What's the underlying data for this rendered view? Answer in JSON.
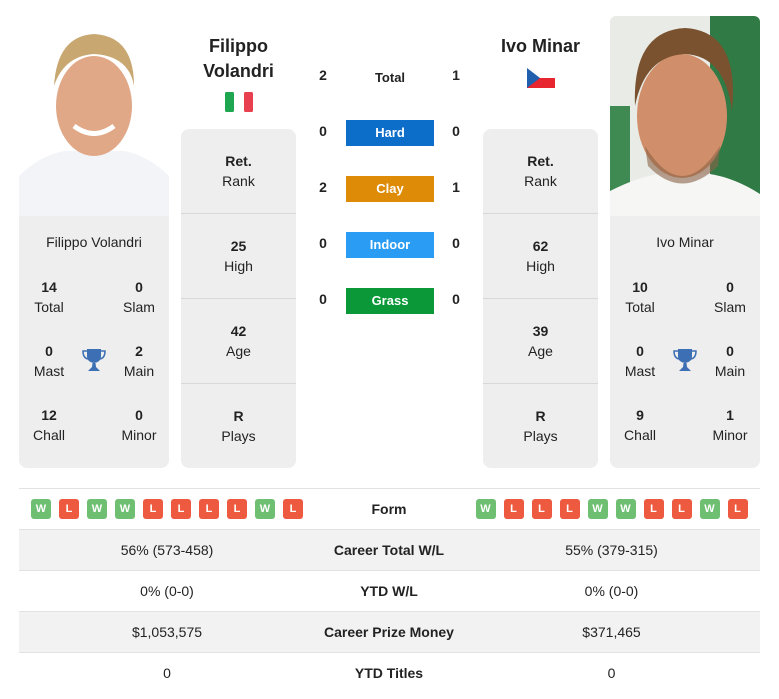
{
  "colors": {
    "hard": "#0c6ec8",
    "clay": "#de8b07",
    "indoor": "#2a9cf3",
    "grass": "#0a9838",
    "win": "#6fbf73",
    "loss": "#ee5a3f",
    "trophy": "#3d6fb4"
  },
  "player1": {
    "name": "Filippo Volandri",
    "name_line1": "Filippo",
    "name_line2": "Volandri",
    "flag": "italy-flag",
    "titles": {
      "total": {
        "value": "14",
        "label": "Total"
      },
      "slam": {
        "value": "0",
        "label": "Slam"
      },
      "mast": {
        "value": "0",
        "label": "Mast"
      },
      "main": {
        "value": "2",
        "label": "Main"
      },
      "chall": {
        "value": "12",
        "label": "Chall"
      },
      "minor": {
        "value": "0",
        "label": "Minor"
      }
    },
    "info": {
      "rank": {
        "value": "Ret.",
        "label": "Rank"
      },
      "high": {
        "value": "25",
        "label": "High"
      },
      "age": {
        "value": "42",
        "label": "Age"
      },
      "plays": {
        "value": "R",
        "label": "Plays"
      }
    },
    "form": [
      "W",
      "L",
      "W",
      "W",
      "L",
      "L",
      "L",
      "L",
      "W",
      "L"
    ],
    "career_wl": "56% (573-458)",
    "ytd_wl": "0% (0-0)",
    "prize_money": "$1,053,575",
    "ytd_titles": "0"
  },
  "player2": {
    "name": "Ivo Minar",
    "flag": "czech-flag",
    "titles": {
      "total": {
        "value": "10",
        "label": "Total"
      },
      "slam": {
        "value": "0",
        "label": "Slam"
      },
      "mast": {
        "value": "0",
        "label": "Mast"
      },
      "main": {
        "value": "0",
        "label": "Main"
      },
      "chall": {
        "value": "9",
        "label": "Chall"
      },
      "minor": {
        "value": "1",
        "label": "Minor"
      }
    },
    "info": {
      "rank": {
        "value": "Ret.",
        "label": "Rank"
      },
      "high": {
        "value": "62",
        "label": "High"
      },
      "age": {
        "value": "39",
        "label": "Age"
      },
      "plays": {
        "value": "R",
        "label": "Plays"
      }
    },
    "form": [
      "W",
      "L",
      "L",
      "L",
      "W",
      "W",
      "L",
      "L",
      "W",
      "L"
    ],
    "career_wl": "55% (379-315)",
    "ytd_wl": "0% (0-0)",
    "prize_money": "$371,465",
    "ytd_titles": "0"
  },
  "h2h": {
    "total": {
      "label": "Total",
      "p1": "2",
      "p2": "1"
    },
    "hard": {
      "label": "Hard",
      "p1": "0",
      "p2": "0"
    },
    "clay": {
      "label": "Clay",
      "p1": "2",
      "p2": "1"
    },
    "indoor": {
      "label": "Indoor",
      "p1": "0",
      "p2": "0"
    },
    "grass": {
      "label": "Grass",
      "p1": "0",
      "p2": "0"
    }
  },
  "stats_labels": {
    "form": "Form",
    "career_wl": "Career Total W/L",
    "ytd_wl": "YTD W/L",
    "prize_money": "Career Prize Money",
    "ytd_titles": "YTD Titles"
  }
}
